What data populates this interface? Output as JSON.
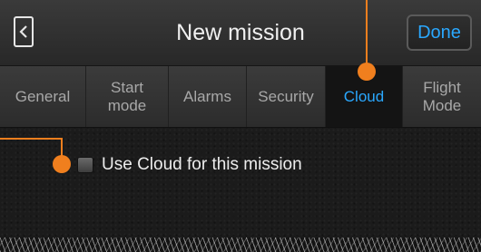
{
  "header": {
    "title": "New mission",
    "done_label": "Done"
  },
  "tabs": [
    {
      "label": "General",
      "active": false
    },
    {
      "label": "Start\nmode",
      "active": false
    },
    {
      "label": "Alarms",
      "active": false
    },
    {
      "label": "Security",
      "active": false
    },
    {
      "label": "Cloud",
      "active": true
    },
    {
      "label": "Flight\nMode",
      "active": false
    }
  ],
  "cloud": {
    "use_cloud_label": "Use Cloud for this mission",
    "use_cloud_checked": false
  },
  "colors": {
    "accent": "#2aa8ff",
    "annotation": "#f07f1e"
  },
  "icons": {
    "back": "chevron-left-icon"
  }
}
